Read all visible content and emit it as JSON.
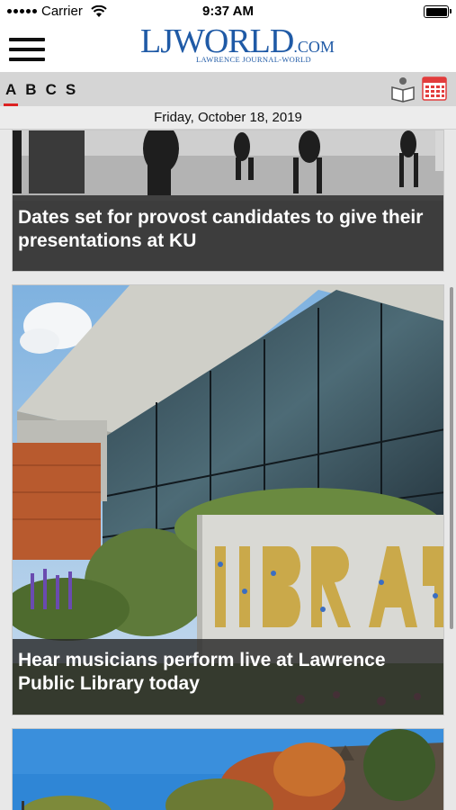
{
  "status_bar": {
    "carrier": "Carrier",
    "time": "9:37 AM"
  },
  "header": {
    "logo_main": "LJWORLD",
    "logo_suffix": ".COM",
    "logo_tagline": "LAWRENCE JOURNAL-WORLD"
  },
  "tabs": [
    {
      "label": "A",
      "active": true
    },
    {
      "label": "B",
      "active": false
    },
    {
      "label": "C",
      "active": false
    },
    {
      "label": "S",
      "active": false
    }
  ],
  "toolbar_icons": [
    "reader-icon",
    "calendar-icon"
  ],
  "date_label": "Friday, October 18, 2019",
  "articles": [
    {
      "headline": "Dates set for provost candidates to give their presentations at KU"
    },
    {
      "headline": "Hear musicians perform live at Lawrence Public Library today"
    },
    {
      "headline": ""
    }
  ],
  "colors": {
    "brand_blue": "#1f5aa6",
    "active_tab_underline": "#dd2222",
    "calendar_red": "#e23c3c"
  }
}
